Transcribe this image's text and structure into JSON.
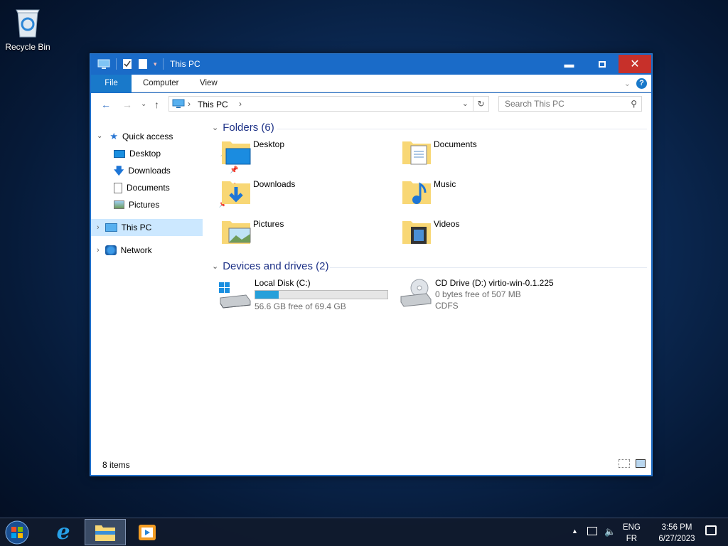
{
  "desktop": {
    "recycle_bin_label": "Recycle Bin"
  },
  "window": {
    "title": "This PC",
    "ribbon_tabs": [
      "File",
      "Computer",
      "View"
    ],
    "address_crumb": "This PC",
    "search_placeholder": "Search This PC",
    "status_count": "8 items"
  },
  "nav": {
    "quick_access": "Quick access",
    "pinned": [
      "Desktop",
      "Downloads",
      "Documents",
      "Pictures"
    ],
    "this_pc": "This PC",
    "network": "Network"
  },
  "content": {
    "folders_header": "Folders (6)",
    "folders": [
      "Desktop",
      "Documents",
      "Downloads",
      "Music",
      "Pictures",
      "Videos"
    ],
    "drives_header": "Devices and drives (2)",
    "drives": [
      {
        "name": "Local Disk (C:)",
        "free": "56.6 GB free of 69.4 GB",
        "used_fraction": 0.18
      },
      {
        "name": "CD Drive (D:) virtio-win-0.1.225",
        "free": "0 bytes free of 507 MB",
        "fs": "CDFS"
      }
    ]
  },
  "taskbar": {
    "lang_top": "ENG",
    "lang_bottom": "FR",
    "time": "3:56 PM",
    "date": "6/27/2023"
  },
  "colors": {
    "accent": "#1979ca",
    "title_bar": "#1a6bc8",
    "close": "#c7302a"
  }
}
